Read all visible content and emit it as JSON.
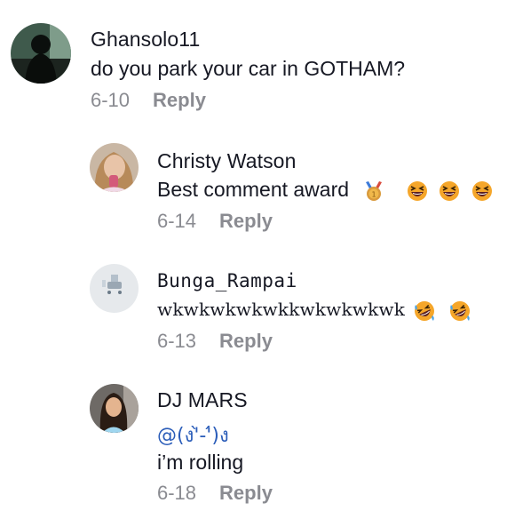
{
  "comments": [
    {
      "username": "Ghansolo11",
      "text": "do you park your car in GOTHAM?",
      "date": "6-10",
      "reply_label": "Reply"
    },
    {
      "username": "Christy Watson",
      "text": "Best comment award",
      "emojis": [
        "medal-icon",
        "grinning-squinting-face-icon",
        "grinning-squinting-face-icon",
        "grinning-squinting-face-icon"
      ],
      "date": "6-14",
      "reply_label": "Reply"
    },
    {
      "username": "Bunga_Rampai",
      "text": "wkwkwkwkwkkwkwkwkwk",
      "emojis": [
        "rolling-on-floor-laughing-icon",
        "rolling-on-floor-laughing-icon"
      ],
      "date": "6-13",
      "reply_label": "Reply"
    },
    {
      "username": "DJ MARS",
      "mention": "@(ง'̀-'́)ง",
      "text": "i’m rolling",
      "date": "6-18",
      "reply_label": "Reply"
    }
  ],
  "colors": {
    "text": "#161823",
    "muted": "#8a8b91",
    "mention": "#2b5db9"
  }
}
